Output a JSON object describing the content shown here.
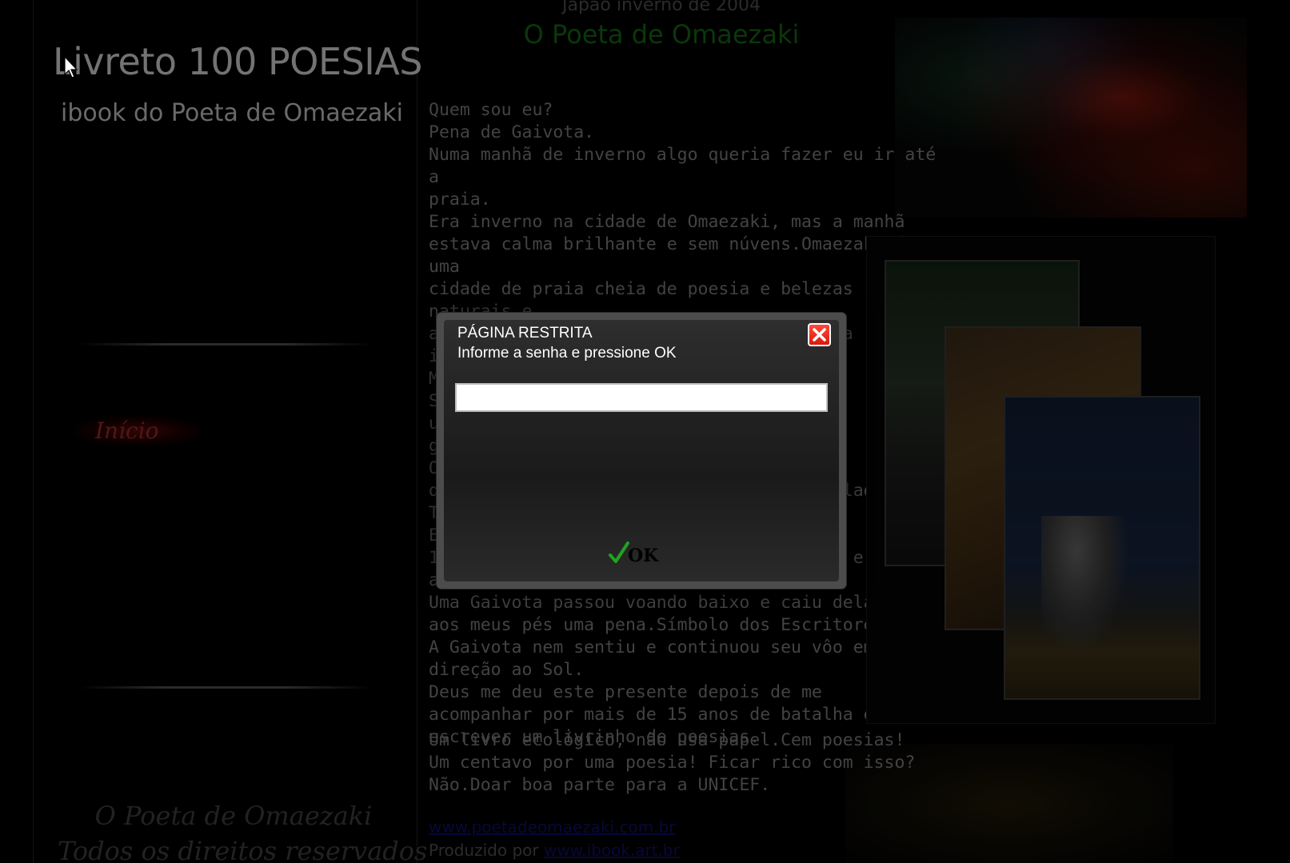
{
  "sidebar": {
    "title": "Livreto 100 POESIAS",
    "subtitle": "ibook do Poeta de Omaezaki",
    "nav_home": "Início",
    "footer_line1": "O Poeta de Omaezaki",
    "footer_line2": "Todos os direitos reservados"
  },
  "main": {
    "top_subtitle": "Japão inverno de 2004",
    "top_title": "O Poeta de Omaezaki",
    "poem": "Quem sou eu?\nPena de Gaivota.\nNuma manhã de inverno algo queria fazer eu ir até a\npraia.\nEra inverno na cidade de Omaezaki, mas a manhã\nestava calma brilhante e sem núvens.Omaezaki é uma\ncidade de praia cheia de poesia e belezas naturais e\nao longe se vê as montanhas.Oásis na zona\nindústrial.\nMontei no meu carrão 200 cavalos!\nS                                          u\nu                                          s\ng\nO\ndourado sobre o mar e o céu estava amarelado.\nTudo dourado!\nEu, mais de 15 anos nesta estrada.\n15 anos de emprego em emprego pelo Japão e\nalguns retornos ao Brasil.\nUma Gaivota passou voando baixo e caiu dela\naos meus pés uma pena.Símbolo dos Escritores!\nA Gaivota nem sentiu e continuou seu vôo em\ndireção ao Sol.\nDeus me deu este presente depois de me\nacompanhar por mais de 15 anos de batalha em\nescrever um livrinho de poesias.",
    "closing": "Um livro ecológico, não usa papel.Cem poesias!\nUm centavo por uma poesia! Ficar rico com isso?\nNão.Doar boa parte para a UNICEF.",
    "link1": "www.poetadeomaezaki.com.br",
    "produced_by_label": "Produzido por",
    "produced_by_link": "www.ibook.art.br"
  },
  "dialog": {
    "title": "PÁGINA RESTRITA",
    "message": "Informe a senha e pressione OK",
    "password_value": "",
    "ok_label": "OK"
  },
  "colors": {
    "background": "#000000",
    "dialog_frame": "#4c4c4c",
    "close_red": "#e0241a",
    "ok_check_green": "#1fa31f",
    "title_green": "#0f4a0f",
    "nav_red": "#6e1e1e"
  },
  "icons": {
    "close": "close-icon",
    "ok": "checkmark-icon",
    "cursor": "mouse-pointer-icon"
  }
}
